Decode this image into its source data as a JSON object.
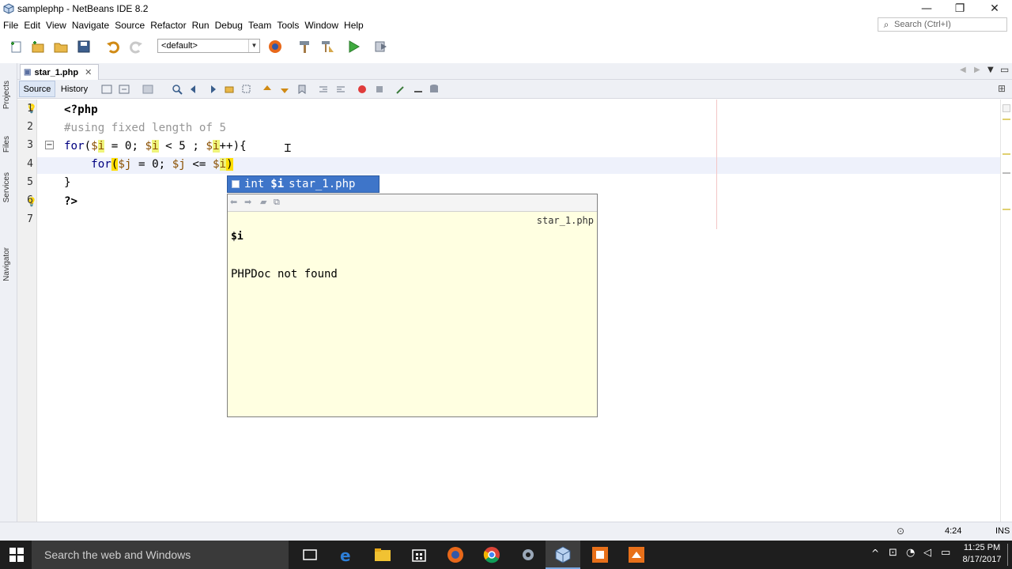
{
  "window": {
    "title": "samplephp - NetBeans IDE 8.2"
  },
  "menu": [
    "File",
    "Edit",
    "View",
    "Navigate",
    "Source",
    "Refactor",
    "Run",
    "Debug",
    "Team",
    "Tools",
    "Window",
    "Help"
  ],
  "search": {
    "placeholder": "Search (Ctrl+I)"
  },
  "toolbar": {
    "config_value": "<default>"
  },
  "side_panels": [
    "Projects",
    "Files",
    "Services",
    "Navigator"
  ],
  "editor": {
    "tab_label": "star_1.php",
    "source_label": "Source",
    "history_label": "History",
    "line_numbers": [
      "1",
      "2",
      "3",
      "4",
      "5",
      "6",
      "7"
    ]
  },
  "completion": {
    "item_type": "int",
    "item_name": "$i",
    "item_file": "star_1.php"
  },
  "doc": {
    "file": "star_1.php",
    "name": "$i",
    "description": "PHPDoc not found"
  },
  "status": {
    "position": "4:24",
    "mode": "INS"
  },
  "taskbar": {
    "search_placeholder": "Search the web and Windows",
    "time": "11:25 PM",
    "date": "8/17/2017"
  }
}
